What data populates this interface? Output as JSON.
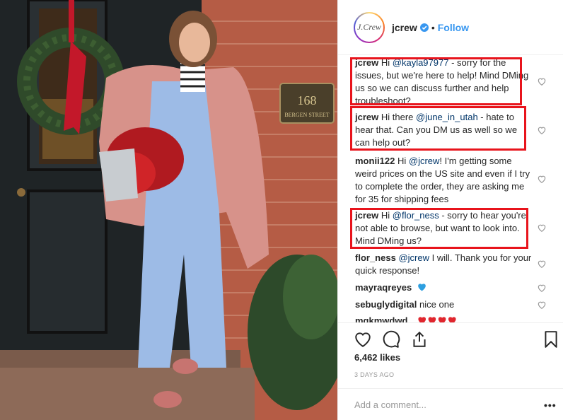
{
  "photo": {
    "house_number": "168",
    "street_sign": "BERGEN STREET"
  },
  "post": {
    "username": "jcrew",
    "avatar_text": "J.Crew",
    "follow_label": "Follow",
    "separator": "•",
    "likes": "6,462 likes",
    "date": "3 DAYS AGO",
    "add_comment_placeholder": "Add a comment...",
    "more_label": "•••"
  },
  "comments": [
    {
      "user": "jcrew",
      "pre": "Hi ",
      "mention": "@kayla97977",
      "post": " - sorry for the issues, but we're here to help! Mind DMing us so we can discuss further and help troubleshoot?"
    },
    {
      "user": "jcrew",
      "pre": "Hi there ",
      "mention": "@june_in_utah",
      "post": " - hate to hear that. Can you DM us as well so we can help out?"
    },
    {
      "user": "monii122",
      "pre": "Hi ",
      "mention": "@jcrew",
      "post": "! I'm getting some weird prices on the US site and even if I try to complete the order, they are asking me for 35 for shipping fees"
    },
    {
      "user": "jcrew",
      "pre": "Hi ",
      "mention": "@flor_ness",
      "post": " - sorry to hear you're not able to browse, but want to look into. Mind DMing us?"
    },
    {
      "user": "flor_ness",
      "pre": "",
      "mention": "@jcrew",
      "post": " I will. Thank you for your quick response!"
    },
    {
      "user": "mayraqreyes",
      "pre": "",
      "mention": "",
      "post": ""
    },
    {
      "user": "sebuglydigital",
      "pre": "nice one",
      "mention": "",
      "post": ""
    },
    {
      "user": "mqkmwdwd",
      "pre": "",
      "mention": "",
      "post": ""
    }
  ],
  "icons": [
    "verified-icon",
    "heart-icon",
    "comment-icon",
    "share-icon",
    "bookmark-icon",
    "blue-heart-emoji",
    "red-heart-emoji"
  ],
  "colors": {
    "accent": "#3897f0",
    "highlight": "#e8141c",
    "mention": "#003569",
    "muted": "#999999"
  }
}
